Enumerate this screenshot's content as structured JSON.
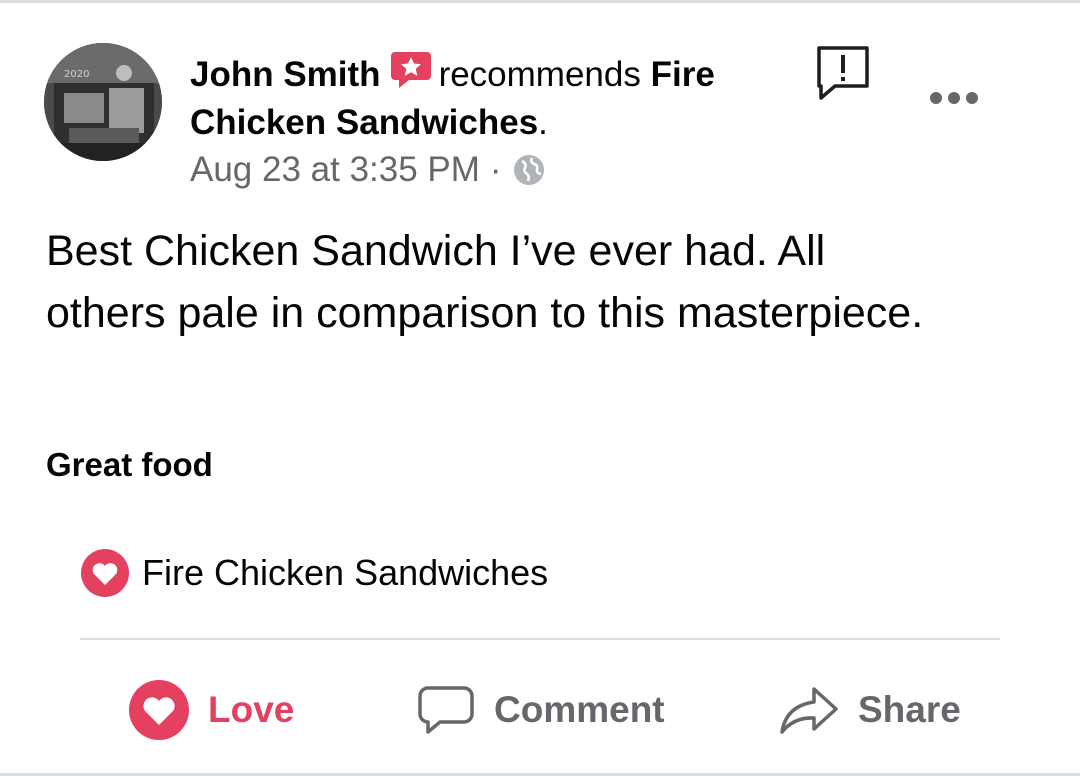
{
  "post": {
    "author": "John Smith",
    "verb": "recommends",
    "page_line1": "Fire",
    "page_line2": "Chicken Sandwiches",
    "period": ".",
    "timestamp": "Aug 23 at 3:35 PM",
    "separator": "·",
    "privacy_icon": "globe-icon",
    "avatar_text": "2020",
    "body": "Best Chicken Sandwich I’ve ever had. All others pale in comparison to this masterpiece.",
    "tag": "Great food"
  },
  "recommendation": {
    "icon": "heart-icon",
    "page_name": "Fire Chicken Sandwiches"
  },
  "actions": {
    "love": "Love",
    "comment": "Comment",
    "share": "Share"
  },
  "icons": {
    "report": "report-icon",
    "more": "more-options-icon",
    "recommend_badge": "recommend-badge-icon"
  },
  "colors": {
    "love_red": "#e4405f",
    "secondary_text": "#65676b",
    "text": "#050505",
    "divider": "#dadde1"
  }
}
